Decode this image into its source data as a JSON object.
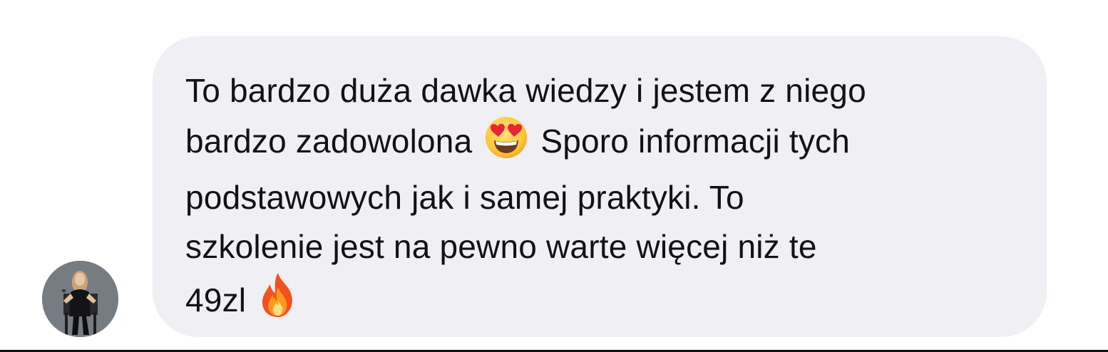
{
  "message": {
    "lines": [
      {
        "text": "To bardzo duża dawka wiedzy i jestem z niego"
      },
      {
        "before": "bardzo zadowolona",
        "emoji": "heart-eyes-emoji",
        "after": "Sporo informacji tych"
      },
      {
        "text": "podstawowych jak i samej praktyki. To"
      },
      {
        "text": "szkolenie jest na pewno warte więcej niż te"
      },
      {
        "before": "49zl",
        "emoji": "fire-emoji"
      }
    ]
  },
  "colors": {
    "bubble": "#efeff4",
    "text": "#121212",
    "background": "#ffffff"
  }
}
